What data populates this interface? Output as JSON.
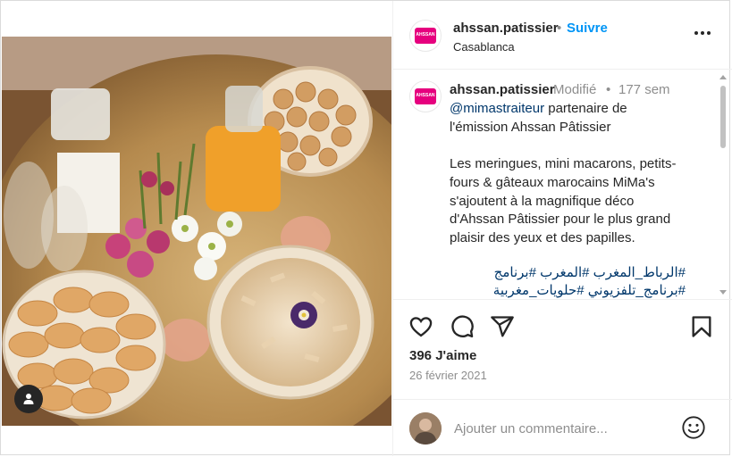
{
  "post": {
    "username": "ahssan.patissier",
    "follow_label": "Suivre",
    "separator": "•",
    "location": "Casablanca",
    "avatar_logo_text": "AHSSAN"
  },
  "caption": {
    "username": "ahssan.patissier",
    "edited_label": "Modifié",
    "separator": "•",
    "time_ago": "177 sem",
    "lines": [
      "@mimastraiteur partenaire de",
      "l'émission Ahssan Pâtissier",
      "Les meringues, mini macarons, petits-",
      "fours & gâteaux marocains MiMa's",
      "s'ajoutent à la magnifique déco",
      "d'Ahssan Pâtissier pour le plus grand",
      "plaisir des yeux et des papilles.",
      "#الرباط_المغرب #المغرب #برنامج",
      "#برنامج_تلفزيوني #حلويات_مغربية"
    ]
  },
  "actions": {
    "like_icon": "heart-icon",
    "comment_icon": "comment-icon",
    "share_icon": "share-icon",
    "save_icon": "bookmark-icon"
  },
  "likes_label": "396 J'aime",
  "date_label": "26 février 2021",
  "comment": {
    "placeholder": "Ajouter un commentaire...",
    "emoji_icon": "emoji-icon"
  },
  "colors": {
    "follow_blue": "#0095f6",
    "link_blue": "#00376b",
    "brand_pink": "#e6007e",
    "muted_gray": "#8e8e8e"
  }
}
